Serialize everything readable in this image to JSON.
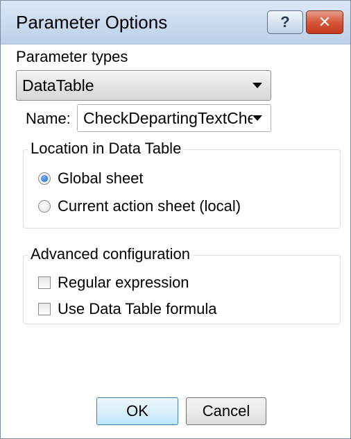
{
  "window": {
    "title": "Parameter Options",
    "help_button": "?",
    "close_button": "✕"
  },
  "parameter_types": {
    "label": "Parameter types",
    "selected": "DataTable"
  },
  "name_field": {
    "label": "Name:",
    "selected": "CheckDepartingTextChe"
  },
  "location_group": {
    "legend": "Location in Data Table",
    "options": [
      {
        "label": "Global sheet",
        "checked": true
      },
      {
        "label": "Current action sheet (local)",
        "checked": false
      }
    ]
  },
  "advanced_group": {
    "legend": "Advanced configuration",
    "options": [
      {
        "label": "Regular expression",
        "checked": false
      },
      {
        "label": "Use Data Table formula",
        "checked": false
      }
    ]
  },
  "buttons": {
    "ok": "OK",
    "cancel": "Cancel"
  },
  "colors": {
    "titlebar": "#c7d9ee",
    "close_button": "#d5553a",
    "ok_border": "#3c7fb1"
  }
}
